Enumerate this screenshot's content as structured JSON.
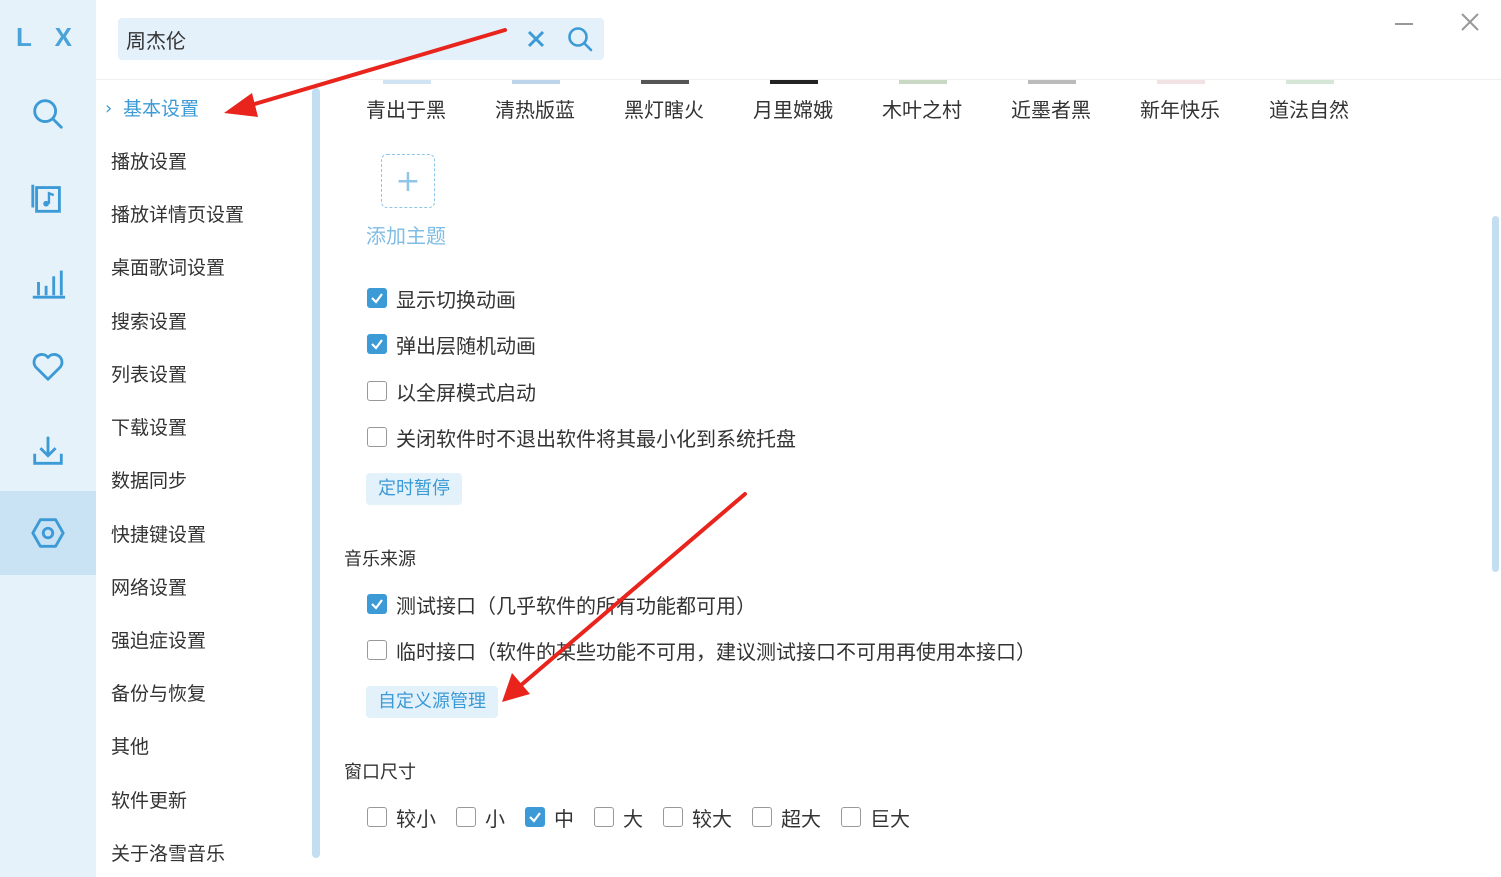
{
  "app": {
    "logo": "L X"
  },
  "search": {
    "value": "周杰伦"
  },
  "nav": {
    "items": [
      {
        "label": "基本设置",
        "active": true
      },
      {
        "label": "播放设置"
      },
      {
        "label": "播放详情页设置"
      },
      {
        "label": "桌面歌词设置"
      },
      {
        "label": "搜索设置"
      },
      {
        "label": "列表设置"
      },
      {
        "label": "下载设置"
      },
      {
        "label": "数据同步"
      },
      {
        "label": "快捷键设置"
      },
      {
        "label": "网络设置"
      },
      {
        "label": "强迫症设置"
      },
      {
        "label": "备份与恢复"
      },
      {
        "label": "其他"
      },
      {
        "label": "软件更新"
      },
      {
        "label": "关于洛雪音乐"
      }
    ]
  },
  "themes": {
    "names": [
      "青出于黑",
      "清热版蓝",
      "黑灯瞎火",
      "月里嫦娥",
      "木叶之村",
      "近墨者黑",
      "新年快乐",
      "道法自然"
    ],
    "add_label": "添加主题",
    "add_symbol": "+"
  },
  "basic": {
    "options": [
      {
        "label": "显示切换动画",
        "checked": true
      },
      {
        "label": "弹出层随机动画",
        "checked": true
      },
      {
        "label": "以全屏模式启动",
        "checked": false
      },
      {
        "label": "关闭软件时不退出软件将其最小化到系统托盘",
        "checked": false
      }
    ],
    "timer_button": "定时暂停"
  },
  "music_source": {
    "title": "音乐来源",
    "options": [
      {
        "label": "测试接口（几乎软件的所有功能都可用）",
        "checked": true
      },
      {
        "label": "临时接口（软件的某些功能不可用，建议测试接口不可用再使用本接口）",
        "checked": false
      }
    ],
    "custom_button": "自定义源管理"
  },
  "window_size": {
    "title": "窗口尺寸",
    "options": [
      {
        "label": "较小",
        "checked": false
      },
      {
        "label": "小",
        "checked": false
      },
      {
        "label": "中",
        "checked": true
      },
      {
        "label": "大",
        "checked": false
      },
      {
        "label": "较大",
        "checked": false
      },
      {
        "label": "超大",
        "checked": false
      },
      {
        "label": "巨大",
        "checked": false
      }
    ]
  },
  "colors": {
    "accent": "#3c9ad6",
    "rail_bg": "#e6f2fa",
    "annotation": "#e8241c"
  }
}
